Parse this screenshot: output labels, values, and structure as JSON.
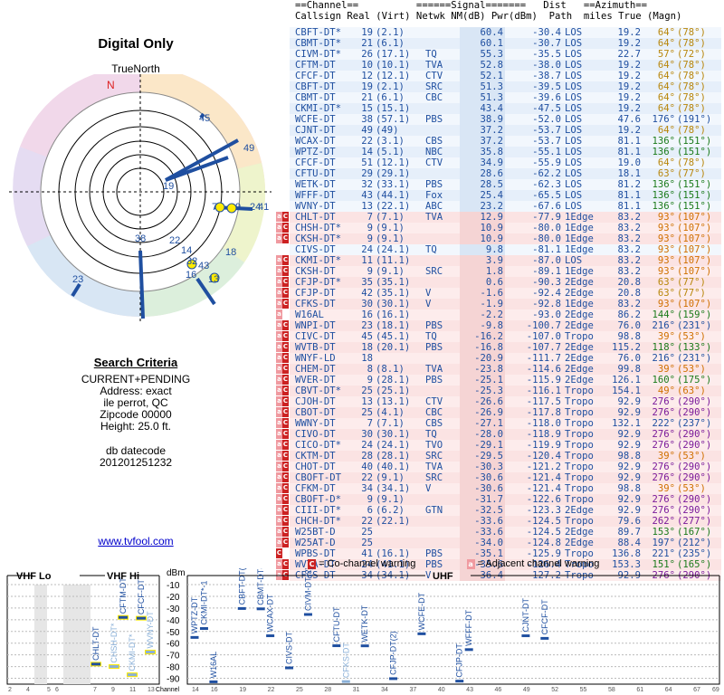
{
  "left": {
    "title": "Digital Only",
    "north_label": "TrueNorth",
    "compass_n": "N",
    "criteria": {
      "heading": "Search Criteria",
      "lines": [
        "CURRENT+PENDING",
        "Address: exact",
        "ile perrot, QC",
        "Zipcode 00000",
        "Height: 25.0 ft."
      ],
      "db_label": "db datecode",
      "db_value": "201201251232"
    },
    "link": "www.tvfool.com"
  },
  "table": {
    "header1": "==Channel==          ======Signal=======   Dist   ==Azimuth==",
    "header2": "Callsign Real (Virt) Netwk NM(dB) Pwr(dBm)  Path  miles True (Magn)",
    "rows": [
      {
        "w": "",
        "call": "CBFT-DT*",
        "real": "19",
        "virt": "(2.1)",
        "net": "",
        "nm": "60.4",
        "pwr": "-30.4",
        "path": "LOS",
        "dist": "19.2",
        "tru": "64°",
        "mag": "(78°)"
      },
      {
        "w": "",
        "call": "CBMT-DT*",
        "real": "21",
        "virt": "(6.1)",
        "net": "",
        "nm": "60.1",
        "pwr": "-30.7",
        "path": "LOS",
        "dist": "19.2",
        "tru": "64°",
        "mag": "(78°)"
      },
      {
        "w": "",
        "call": "CIVM-DT*",
        "real": "26",
        "virt": "(17.1)",
        "net": "TQ",
        "nm": "55.3",
        "pwr": "-35.5",
        "path": "LOS",
        "dist": "22.7",
        "tru": "57°",
        "mag": "(72°)"
      },
      {
        "w": "",
        "call": "CFTM-DT",
        "real": "10",
        "virt": "(10.1)",
        "net": "TVA",
        "nm": "52.8",
        "pwr": "-38.0",
        "path": "LOS",
        "dist": "19.2",
        "tru": "64°",
        "mag": "(78°)"
      },
      {
        "w": "",
        "call": "CFCF-DT",
        "real": "12",
        "virt": "(12.1)",
        "net": "CTV",
        "nm": "52.1",
        "pwr": "-38.7",
        "path": "LOS",
        "dist": "19.2",
        "tru": "64°",
        "mag": "(78°)"
      },
      {
        "w": "",
        "call": "CBFT-DT",
        "real": "19",
        "virt": "(2.1)",
        "net": "SRC",
        "nm": "51.3",
        "pwr": "-39.5",
        "path": "LOS",
        "dist": "19.2",
        "tru": "64°",
        "mag": "(78°)"
      },
      {
        "w": "",
        "call": "CBMT-DT",
        "real": "21",
        "virt": "(6.1)",
        "net": "CBC",
        "nm": "51.3",
        "pwr": "-39.6",
        "path": "LOS",
        "dist": "19.2",
        "tru": "64°",
        "mag": "(78°)"
      },
      {
        "w": "",
        "call": "CKMI-DT*",
        "real": "15",
        "virt": "(15.1)",
        "net": "",
        "nm": "43.4",
        "pwr": "-47.5",
        "path": "LOS",
        "dist": "19.2",
        "tru": "64°",
        "mag": "(78°)"
      },
      {
        "w": "",
        "call": "WCFE-DT",
        "real": "38",
        "virt": "(57.1)",
        "net": "PBS",
        "nm": "38.9",
        "pwr": "-52.0",
        "path": "LOS",
        "dist": "47.6",
        "tru": "176°",
        "mag": "(191°)"
      },
      {
        "w": "",
        "call": "CJNT-DT",
        "real": "49",
        "virt": "(49)",
        "net": "",
        "nm": "37.2",
        "pwr": "-53.7",
        "path": "LOS",
        "dist": "19.2",
        "tru": "64°",
        "mag": "(78°)"
      },
      {
        "w": "",
        "call": "WCAX-DT",
        "real": "22",
        "virt": "(3.1)",
        "net": "CBS",
        "nm": "37.2",
        "pwr": "-53.7",
        "path": "LOS",
        "dist": "81.1",
        "tru": "136°",
        "mag": "(151°)"
      },
      {
        "w": "",
        "call": "WPTZ-DT",
        "real": "14",
        "virt": "(5.1)",
        "net": "NBC",
        "nm": "35.8",
        "pwr": "-55.1",
        "path": "LOS",
        "dist": "81.1",
        "tru": "136°",
        "mag": "(151°)"
      },
      {
        "w": "",
        "call": "CFCF-DT",
        "real": "51",
        "virt": "(12.1)",
        "net": "CTV",
        "nm": "34.9",
        "pwr": "-55.9",
        "path": "LOS",
        "dist": "19.0",
        "tru": "64°",
        "mag": "(78°)"
      },
      {
        "w": "",
        "call": "CFTU-DT",
        "real": "29",
        "virt": "(29.1)",
        "net": "",
        "nm": "28.6",
        "pwr": "-62.2",
        "path": "LOS",
        "dist": "18.1",
        "tru": "63°",
        "mag": "(77°)"
      },
      {
        "w": "",
        "call": "WETK-DT",
        "real": "32",
        "virt": "(33.1)",
        "net": "PBS",
        "nm": "28.5",
        "pwr": "-62.3",
        "path": "LOS",
        "dist": "81.2",
        "tru": "136°",
        "mag": "(151°)"
      },
      {
        "w": "",
        "call": "WFFF-DT",
        "real": "43",
        "virt": "(44.1)",
        "net": "Fox",
        "nm": "25.4",
        "pwr": "-65.5",
        "path": "LOS",
        "dist": "81.1",
        "tru": "136°",
        "mag": "(151°)"
      },
      {
        "w": "",
        "call": "WVNY-DT",
        "real": "13",
        "virt": "(22.1)",
        "net": "ABC",
        "nm": "23.2",
        "pwr": "-67.6",
        "path": "LOS",
        "dist": "81.1",
        "tru": "136°",
        "mag": "(151°)"
      },
      {
        "w": "aC",
        "call": "CHLT-DT",
        "real": "7",
        "virt": "(7.1)",
        "net": "TVA",
        "nm": "12.9",
        "pwr": "-77.9",
        "path": "1Edge",
        "dist": "83.2",
        "tru": "93°",
        "mag": "(107°)"
      },
      {
        "w": "aC",
        "call": "CHSH-DT*",
        "real": "9",
        "virt": "(9.1)",
        "net": "",
        "nm": "10.9",
        "pwr": "-80.0",
        "path": "1Edge",
        "dist": "83.2",
        "tru": "93°",
        "mag": "(107°)"
      },
      {
        "w": "aC",
        "call": "CKSH-DT*",
        "real": "9",
        "virt": "(9.1)",
        "net": "",
        "nm": "10.9",
        "pwr": "-80.0",
        "path": "1Edge",
        "dist": "83.2",
        "tru": "93°",
        "mag": "(107°)"
      },
      {
        "w": "",
        "call": "CIVS-DT",
        "real": "24",
        "virt": "(24.1)",
        "net": "TQ",
        "nm": "9.8",
        "pwr": "-81.1",
        "path": "1Edge",
        "dist": "83.2",
        "tru": "93°",
        "mag": "(107°)"
      },
      {
        "w": "aC",
        "call": "CKMI-DT*",
        "real": "11",
        "virt": "(11.1)",
        "net": "",
        "nm": "3.9",
        "pwr": "-87.0",
        "path": "LOS",
        "dist": "83.2",
        "tru": "93°",
        "mag": "(107°)"
      },
      {
        "w": "aC",
        "call": "CKSH-DT",
        "real": "9",
        "virt": "(9.1)",
        "net": "SRC",
        "nm": "1.8",
        "pwr": "-89.1",
        "path": "1Edge",
        "dist": "83.2",
        "tru": "93°",
        "mag": "(107°)"
      },
      {
        "w": "aC",
        "call": "CFJP-DT*",
        "real": "35",
        "virt": "(35.1)",
        "net": "",
        "nm": "0.6",
        "pwr": "-90.3",
        "path": "2Edge",
        "dist": "20.8",
        "tru": "63°",
        "mag": "(77°)"
      },
      {
        "w": "aC",
        "call": "CFJP-DT",
        "real": "42",
        "virt": "(35.1)",
        "net": "V",
        "nm": "-1.6",
        "pwr": "-92.4",
        "path": "2Edge",
        "dist": "20.8",
        "tru": "63°",
        "mag": "(77°)"
      },
      {
        "w": "aC",
        "call": "CFKS-DT",
        "real": "30",
        "virt": "(30.1)",
        "net": "V",
        "nm": "-1.9",
        "pwr": "-92.8",
        "path": "1Edge",
        "dist": "83.2",
        "tru": "93°",
        "mag": "(107°)"
      },
      {
        "w": "a",
        "call": "W16AL",
        "real": "16",
        "virt": "(16.1)",
        "net": "",
        "nm": "-2.2",
        "pwr": "-93.0",
        "path": "2Edge",
        "dist": "86.2",
        "tru": "144°",
        "mag": "(159°)"
      },
      {
        "w": "aC",
        "call": "WNPI-DT",
        "real": "23",
        "virt": "(18.1)",
        "net": "PBS",
        "nm": "-9.8",
        "pwr": "-100.7",
        "path": "2Edge",
        "dist": "76.0",
        "tru": "216°",
        "mag": "(231°)"
      },
      {
        "w": "aC",
        "call": "CIVC-DT",
        "real": "45",
        "virt": "(45.1)",
        "net": "TQ",
        "nm": "-16.2",
        "pwr": "-107.0",
        "path": "Tropo",
        "dist": "98.8",
        "tru": "39°",
        "mag": "(53°)"
      },
      {
        "w": "aC",
        "call": "WVTB-DT",
        "real": "18",
        "virt": "(20.1)",
        "net": "PBS",
        "nm": "-16.8",
        "pwr": "-107.7",
        "path": "2Edge",
        "dist": "115.2",
        "tru": "118°",
        "mag": "(133°)"
      },
      {
        "w": "aC",
        "call": "WNYF-LD",
        "real": "18",
        "virt": "",
        "net": "",
        "nm": "-20.9",
        "pwr": "-111.7",
        "path": "2Edge",
        "dist": "76.0",
        "tru": "216°",
        "mag": "(231°)"
      },
      {
        "w": "aC",
        "call": "CHEM-DT",
        "real": "8",
        "virt": "(8.1)",
        "net": "TVA",
        "nm": "-23.8",
        "pwr": "-114.6",
        "path": "2Edge",
        "dist": "99.8",
        "tru": "39°",
        "mag": "(53°)"
      },
      {
        "w": "aC",
        "call": "WVER-DT",
        "real": "9",
        "virt": "(28.1)",
        "net": "PBS",
        "nm": "-25.1",
        "pwr": "-115.9",
        "path": "2Edge",
        "dist": "126.1",
        "tru": "160°",
        "mag": "(175°)"
      },
      {
        "w": "aC",
        "call": "CBVT-DT*",
        "real": "25",
        "virt": "(25.1)",
        "net": "",
        "nm": "-25.3",
        "pwr": "-116.1",
        "path": "Tropo",
        "dist": "154.1",
        "tru": "49°",
        "mag": "(63°)"
      },
      {
        "w": "aC",
        "call": "CJOH-DT",
        "real": "13",
        "virt": "(13.1)",
        "net": "CTV",
        "nm": "-26.6",
        "pwr": "-117.5",
        "path": "Tropo",
        "dist": "92.9",
        "tru": "276°",
        "mag": "(290°)"
      },
      {
        "w": "aC",
        "call": "CBOT-DT",
        "real": "25",
        "virt": "(4.1)",
        "net": "CBC",
        "nm": "-26.9",
        "pwr": "-117.8",
        "path": "Tropo",
        "dist": "92.9",
        "tru": "276°",
        "mag": "(290°)"
      },
      {
        "w": "aC",
        "call": "WWNY-DT",
        "real": "7",
        "virt": "(7.1)",
        "net": "CBS",
        "nm": "-27.1",
        "pwr": "-118.0",
        "path": "Tropo",
        "dist": "132.1",
        "tru": "222°",
        "mag": "(237°)"
      },
      {
        "w": "aC",
        "call": "CIVO-DT",
        "real": "30",
        "virt": "(30.1)",
        "net": "TQ",
        "nm": "-28.0",
        "pwr": "-118.9",
        "path": "Tropo",
        "dist": "92.9",
        "tru": "276°",
        "mag": "(290°)"
      },
      {
        "w": "aC",
        "call": "CICO-DT*",
        "real": "24",
        "virt": "(24.1)",
        "net": "TVO",
        "nm": "-29.1",
        "pwr": "-119.9",
        "path": "Tropo",
        "dist": "92.9",
        "tru": "276°",
        "mag": "(290°)"
      },
      {
        "w": "aC",
        "call": "CKTM-DT",
        "real": "28",
        "virt": "(28.1)",
        "net": "SRC",
        "nm": "-29.5",
        "pwr": "-120.4",
        "path": "Tropo",
        "dist": "98.8",
        "tru": "39°",
        "mag": "(53°)"
      },
      {
        "w": "aC",
        "call": "CHOT-DT",
        "real": "40",
        "virt": "(40.1)",
        "net": "TVA",
        "nm": "-30.3",
        "pwr": "-121.2",
        "path": "Tropo",
        "dist": "92.9",
        "tru": "276°",
        "mag": "(290°)"
      },
      {
        "w": "aC",
        "call": "CBOFT-DT",
        "real": "22",
        "virt": "(9.1)",
        "net": "SRC",
        "nm": "-30.6",
        "pwr": "-121.4",
        "path": "Tropo",
        "dist": "92.9",
        "tru": "276°",
        "mag": "(290°)"
      },
      {
        "w": "aC",
        "call": "CFKM-DT",
        "real": "34",
        "virt": "(34.1)",
        "net": "V",
        "nm": "-30.6",
        "pwr": "-121.4",
        "path": "Tropo",
        "dist": "98.8",
        "tru": "39°",
        "mag": "(53°)"
      },
      {
        "w": "aC",
        "call": "CBOFT-D*",
        "real": "9",
        "virt": "(9.1)",
        "net": "",
        "nm": "-31.7",
        "pwr": "-122.6",
        "path": "Tropo",
        "dist": "92.9",
        "tru": "276°",
        "mag": "(290°)"
      },
      {
        "w": "aC",
        "call": "CIII-DT*",
        "real": "6",
        "virt": "(6.2)",
        "net": "GTN",
        "nm": "-32.5",
        "pwr": "-123.3",
        "path": "2Edge",
        "dist": "92.9",
        "tru": "276°",
        "mag": "(290°)"
      },
      {
        "w": "aC",
        "call": "CHCH-DT*",
        "real": "22",
        "virt": "(22.1)",
        "net": "",
        "nm": "-33.6",
        "pwr": "-124.5",
        "path": "Tropo",
        "dist": "79.6",
        "tru": "262°",
        "mag": "(277°)"
      },
      {
        "w": "aC",
        "call": "W25BT-D",
        "real": "25",
        "virt": "",
        "net": "",
        "nm": "-33.6",
        "pwr": "-124.5",
        "path": "2Edge",
        "dist": "89.7",
        "tru": "153°",
        "mag": "(167°)"
      },
      {
        "w": "aC",
        "call": "W25AT-D",
        "real": "25",
        "virt": "",
        "net": "",
        "nm": "-34.0",
        "pwr": "-124.8",
        "path": "2Edge",
        "dist": "88.4",
        "tru": "197°",
        "mag": "(212°)"
      },
      {
        "w": "C",
        "call": "WPBS-DT",
        "real": "41",
        "virt": "(16.1)",
        "net": "PBS",
        "nm": "-35.1",
        "pwr": "-125.9",
        "path": "Tropo",
        "dist": "136.8",
        "tru": "221°",
        "mag": "(235°)"
      },
      {
        "w": "aC",
        "call": "WVTA-DT",
        "real": "24",
        "virt": "(41.1)",
        "net": "PBS",
        "nm": "-35.6",
        "pwr": "-126.4",
        "path": "Tropo",
        "dist": "153.3",
        "tru": "151°",
        "mag": "(165°)"
      },
      {
        "w": "aC",
        "call": "CFGS-DT",
        "real": "34",
        "virt": "(34.1)",
        "net": "V",
        "nm": "-36.4",
        "pwr": "-127.2",
        "path": "Tropo",
        "dist": "92.9",
        "tru": "276°",
        "mag": "(290°)"
      }
    ]
  },
  "legend": {
    "cochannel": "= Co-channel warning",
    "adjacent": "= Adjacent channel warning",
    "c_box": "C",
    "a_box": "a"
  },
  "spectrum": {
    "vhf_lo": "VHF Lo",
    "vhf_hi": "VHF Hi",
    "uhf": "UHF",
    "dbm_label": "dBm",
    "channel_label": "Channel",
    "dbm_ticks": [
      "-10",
      "-20",
      "-30",
      "-40",
      "-50",
      "-60",
      "-70",
      "-80",
      "-90"
    ],
    "lo_ticks": [
      "2",
      "4",
      "5",
      "6"
    ],
    "hi_ticks": [
      "7",
      "9",
      "11",
      "13"
    ],
    "uhf_ticks": [
      "14",
      "16",
      "19",
      "22",
      "25",
      "28",
      "31",
      "34",
      "37",
      "40",
      "43",
      "46",
      "49",
      "52",
      "55",
      "58",
      "61",
      "64",
      "67",
      "69"
    ],
    "stations": [
      {
        "label": "CHLT-DT",
        "ch": 7,
        "dbm": -77.9,
        "color": "#1f4fa0",
        "warn": true
      },
      {
        "label": "CHSH-DT*",
        "ch": 9,
        "dbm": -80.0,
        "color": "#8ab0d8",
        "warn": true
      },
      {
        "label": "CFTM-DT",
        "ch": 10,
        "dbm": -38.0,
        "color": "#1f4fa0",
        "warn": true
      },
      {
        "label": "CKMI-DT*",
        "ch": 11,
        "dbm": -87.0,
        "color": "#8ab0d8",
        "warn": true
      },
      {
        "label": "CFCF-DT",
        "ch": 12,
        "dbm": -38.7,
        "color": "#1f4fa0",
        "warn": true
      },
      {
        "label": "WVNY-DT",
        "ch": 13,
        "dbm": -67.6,
        "color": "#8ab0d8",
        "warn": true
      },
      {
        "label": "WPTZ-DT",
        "ch": 14,
        "dbm": -55.1,
        "color": "#1f4fa0",
        "warn": false
      },
      {
        "label": "CKMI-DT*-1",
        "ch": 15,
        "dbm": -47.5,
        "color": "#1f4fa0",
        "warn": false
      },
      {
        "label": "W16AL",
        "ch": 16,
        "dbm": -93.0,
        "color": "#1f4fa0",
        "warn": false
      },
      {
        "label": "CBFT-DT(2)",
        "ch": 19,
        "dbm": -30.4,
        "color": "#1f4fa0",
        "warn": false
      },
      {
        "label": "CBMT-DT(2)",
        "ch": 21,
        "dbm": -30.7,
        "color": "#1f4fa0",
        "warn": false
      },
      {
        "label": "WCAX-DT",
        "ch": 22,
        "dbm": -53.7,
        "color": "#1f4fa0",
        "warn": false
      },
      {
        "label": "CIVS-DT",
        "ch": 24,
        "dbm": -81.1,
        "color": "#1f4fa0",
        "warn": false
      },
      {
        "label": "CIVM-DT(2)",
        "ch": 26,
        "dbm": -35.5,
        "color": "#1f4fa0",
        "warn": false
      },
      {
        "label": "CFTU-DT",
        "ch": 29,
        "dbm": -62.2,
        "color": "#1f4fa0",
        "warn": false
      },
      {
        "label": "CFKS-DT",
        "ch": 30,
        "dbm": -92.8,
        "color": "#8ab0d8",
        "warn": false
      },
      {
        "label": "WETK-DT",
        "ch": 32,
        "dbm": -62.3,
        "color": "#1f4fa0",
        "warn": false
      },
      {
        "label": "CFJP-DT(2)",
        "ch": 35,
        "dbm": -90.3,
        "color": "#1f4fa0",
        "warn": false
      },
      {
        "label": "WCFE-DT",
        "ch": 38,
        "dbm": -52.0,
        "color": "#1f4fa0",
        "warn": false
      },
      {
        "label": "CFJP-DT",
        "ch": 42,
        "dbm": -92.4,
        "color": "#1f4fa0",
        "warn": false
      },
      {
        "label": "WFFF-DT",
        "ch": 43,
        "dbm": -65.5,
        "color": "#1f4fa0",
        "warn": false
      },
      {
        "label": "CJNT-DT",
        "ch": 49,
        "dbm": -53.7,
        "color": "#1f4fa0",
        "warn": false
      },
      {
        "label": "CFCF-DT",
        "ch": 51,
        "dbm": -55.9,
        "color": "#1f4fa0",
        "warn": false
      }
    ]
  },
  "radar": {
    "labels": [
      "45",
      "49",
      "19",
      "22",
      "14",
      "32",
      "43",
      "13",
      "18",
      "38",
      "23",
      "7",
      "24",
      "41",
      "16",
      "9"
    ],
    "colors": {
      "primary": "#1f4fa0",
      "highlight": "#ffea00"
    }
  }
}
